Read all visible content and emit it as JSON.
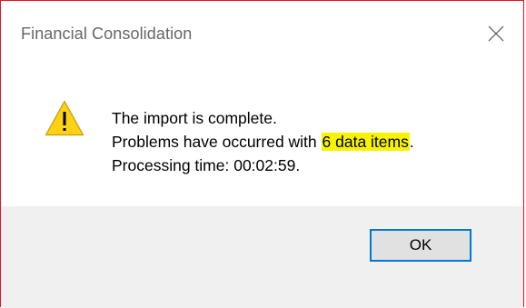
{
  "window": {
    "title": "Financial Consolidation",
    "close_icon": "close-icon"
  },
  "message": {
    "icon": "warning-icon",
    "line1": "The import is complete.",
    "line2_prefix": "Problems have occurred with ",
    "line2_highlight": "6 data items",
    "line2_suffix": ".",
    "line3": "Processing time: 00:02:59."
  },
  "buttons": {
    "ok_label": "OK"
  },
  "colors": {
    "window_border": "#e81123",
    "highlight": "#f8f400",
    "button_border": "#0078d7",
    "button_bar": "#f0f0f0",
    "warning_fill": "#fcd116"
  }
}
